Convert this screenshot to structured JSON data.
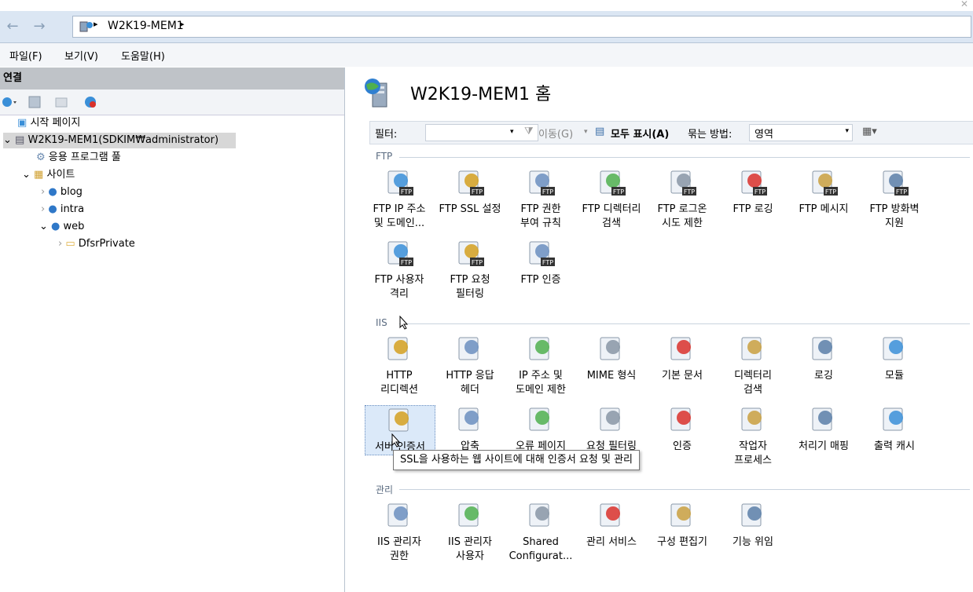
{
  "address": {
    "path": "W2K19-MEM1",
    "separator": "▸"
  },
  "menu": [
    "파일(F)",
    "보기(V)",
    "도움말(H)"
  ],
  "connections": {
    "header": "연결",
    "tree": [
      {
        "label": "시작 페이지"
      },
      {
        "label": "W2K19-MEM1(SDKIM₩administrator)"
      },
      {
        "label": "응용 프로그램 풀"
      },
      {
        "label": "사이트"
      },
      {
        "label": "blog"
      },
      {
        "label": "intra"
      },
      {
        "label": "web"
      },
      {
        "label": "DfsrPrivate"
      }
    ]
  },
  "main": {
    "title": "W2K19-MEM1 홈",
    "filter": {
      "label": "필터:",
      "go": "이동(G)",
      "show_all": "모두 표시(A)",
      "group_by": "묶는 방법:",
      "group_value": "영역"
    },
    "sections": [
      {
        "name": "FTP",
        "items": [
          {
            "line1": "FTP IP 주소",
            "line2": "및 도메인..."
          },
          {
            "line1": "FTP SSL 설정",
            "line2": ""
          },
          {
            "line1": "FTP 권한",
            "line2": "부여 규칙"
          },
          {
            "line1": "FTP 디렉터리",
            "line2": "검색"
          },
          {
            "line1": "FTP 로그온",
            "line2": "시도 제한"
          },
          {
            "line1": "FTP 로깅",
            "line2": ""
          },
          {
            "line1": "FTP 메시지",
            "line2": ""
          },
          {
            "line1": "FTP 방화벽",
            "line2": "지원"
          },
          {
            "line1": "FTP 사용자",
            "line2": "격리"
          },
          {
            "line1": "FTP 요청",
            "line2": "필터링"
          },
          {
            "line1": "FTP 인증",
            "line2": ""
          }
        ]
      },
      {
        "name": "IIS",
        "items": [
          {
            "line1": "HTTP",
            "line2": "리디렉션"
          },
          {
            "line1": "HTTP 응답",
            "line2": "헤더"
          },
          {
            "line1": "IP 주소 및",
            "line2": "도메인 제한"
          },
          {
            "line1": "MIME 형식",
            "line2": ""
          },
          {
            "line1": "기본 문서",
            "line2": ""
          },
          {
            "line1": "디렉터리",
            "line2": "검색"
          },
          {
            "line1": "로깅",
            "line2": ""
          },
          {
            "line1": "모듈",
            "line2": ""
          },
          {
            "line1": "서버 인증서",
            "line2": ""
          },
          {
            "line1": "압축",
            "line2": ""
          },
          {
            "line1": "오류 페이지",
            "line2": ""
          },
          {
            "line1": "요청 필터링",
            "line2": ""
          },
          {
            "line1": "인증",
            "line2": ""
          },
          {
            "line1": "작업자",
            "line2": "프로세스"
          },
          {
            "line1": "처리기 매핑",
            "line2": ""
          },
          {
            "line1": "출력 캐시",
            "line2": ""
          }
        ]
      },
      {
        "name": "관리",
        "items": [
          {
            "line1": "IIS 관리자",
            "line2": "권한"
          },
          {
            "line1": "IIS 관리자",
            "line2": "사용자"
          },
          {
            "line1": "Shared",
            "line2": "Configurat..."
          },
          {
            "line1": "관리 서비스",
            "line2": ""
          },
          {
            "line1": "구성 편집기",
            "line2": ""
          },
          {
            "line1": "기능 위임",
            "line2": ""
          }
        ]
      }
    ],
    "tooltip": "SSL을 사용하는 웹 사이트에 대해 인증서 요청 및 관리"
  },
  "colors": {
    "accent": "#dbe6f3",
    "selection": "#dbe9f9",
    "panel_header": "#bfc3c8"
  }
}
